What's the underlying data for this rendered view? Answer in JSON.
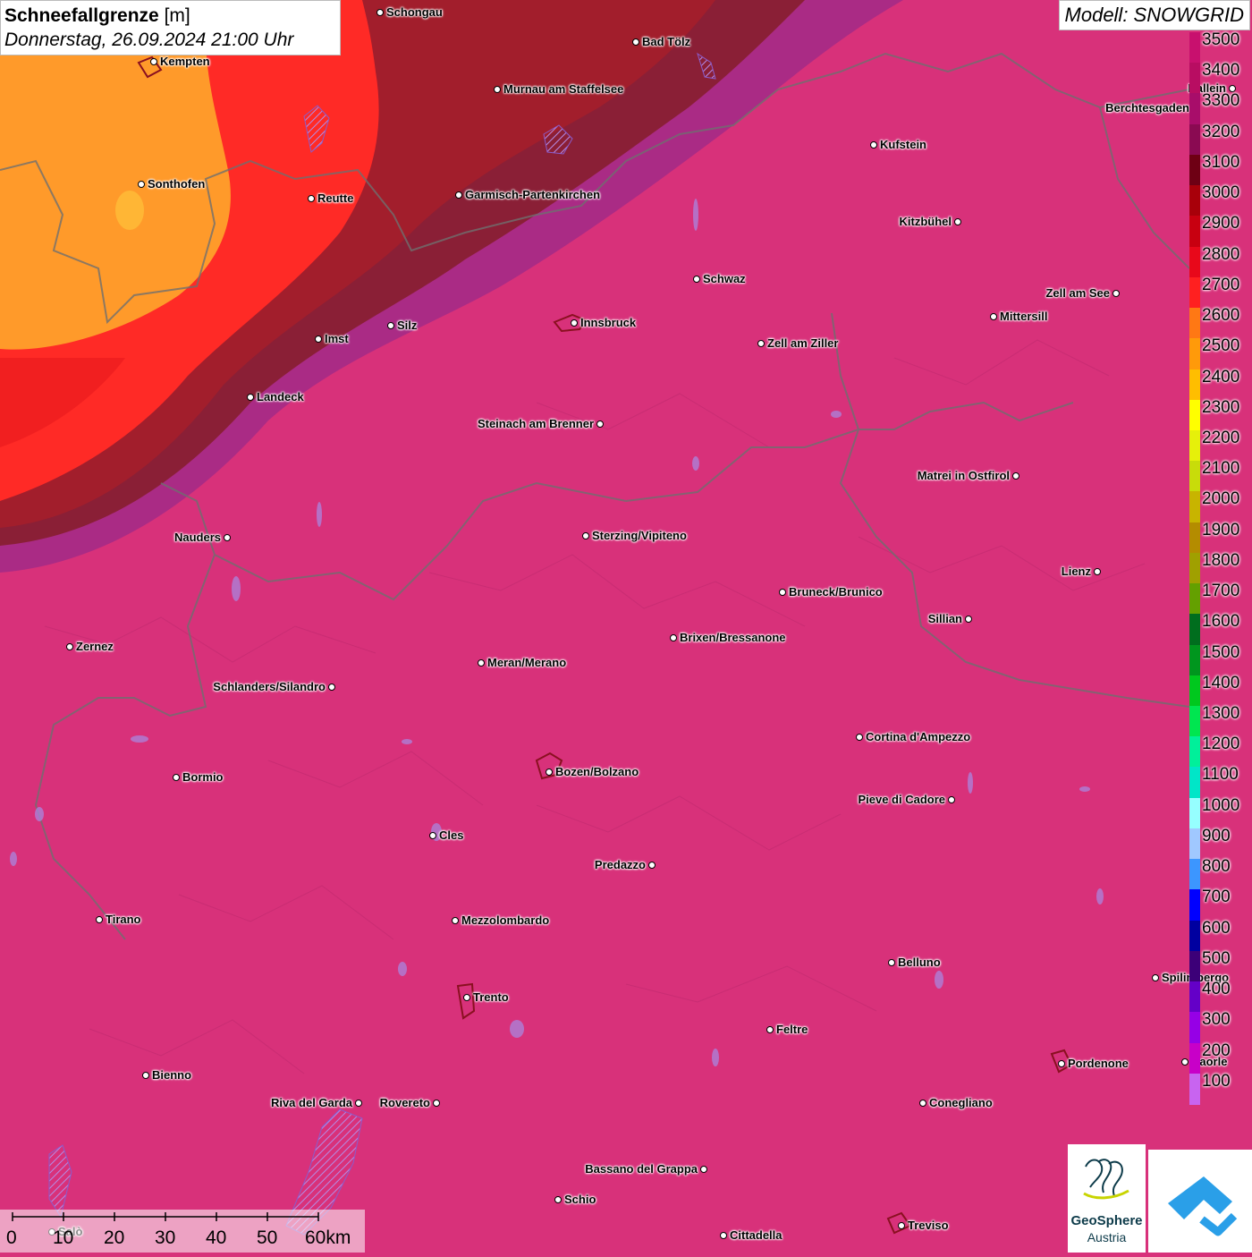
{
  "title": {
    "name": "Schneefallgrenze",
    "unit": "[m]",
    "datetime": "Donnerstag, 26.09.2024 21:00 Uhr"
  },
  "model": "Modell: SNOWGRID",
  "legend": [
    {
      "label": "3500",
      "color": "#c8106e"
    },
    {
      "label": "3400",
      "color": "#b80d62"
    },
    {
      "label": "3300",
      "color": "#a80d6a"
    },
    {
      "label": "3200",
      "color": "#8a0a52"
    },
    {
      "label": "3100",
      "color": "#6e0014"
    },
    {
      "label": "3000",
      "color": "#a8000a"
    },
    {
      "label": "2900",
      "color": "#c80010"
    },
    {
      "label": "2800",
      "color": "#e8081a"
    },
    {
      "label": "2700",
      "color": "#ff2020"
    },
    {
      "label": "2600",
      "color": "#ff7814"
    },
    {
      "label": "2500",
      "color": "#ff9a0a"
    },
    {
      "label": "2400",
      "color": "#ffbe00"
    },
    {
      "label": "2300",
      "color": "#ffff00"
    },
    {
      "label": "2200",
      "color": "#e6f00a"
    },
    {
      "label": "2100",
      "color": "#c8dc0a"
    },
    {
      "label": "2000",
      "color": "#c8b400"
    },
    {
      "label": "1900",
      "color": "#b48c00"
    },
    {
      "label": "1800",
      "color": "#a0a000"
    },
    {
      "label": "1700",
      "color": "#64a000"
    },
    {
      "label": "1600",
      "color": "#006e1e"
    },
    {
      "label": "1500",
      "color": "#00961e"
    },
    {
      "label": "1400",
      "color": "#00c81e"
    },
    {
      "label": "1300",
      "color": "#00e650"
    },
    {
      "label": "1200",
      "color": "#00f09a"
    },
    {
      "label": "1100",
      "color": "#00e6c8"
    },
    {
      "label": "1000",
      "color": "#96ffff"
    },
    {
      "label": "900",
      "color": "#a0c8ff"
    },
    {
      "label": "800",
      "color": "#3c96ff"
    },
    {
      "label": "700",
      "color": "#0000ff"
    },
    {
      "label": "600",
      "color": "#0000a0"
    },
    {
      "label": "500",
      "color": "#3c0078"
    },
    {
      "label": "400",
      "color": "#6400c8"
    },
    {
      "label": "300",
      "color": "#9600e6"
    },
    {
      "label": "200",
      "color": "#c800c8"
    },
    {
      "label": "100",
      "color": "#c864f0"
    }
  ],
  "cities": [
    {
      "name": "Schongau",
      "side": "r"
    },
    {
      "name": "Bad Tölz",
      "side": "r"
    },
    {
      "name": "Kempten",
      "side": "r"
    },
    {
      "name": "Murnau am Staffelsee",
      "side": "r"
    },
    {
      "name": "Berchtesgaden",
      "side": "l"
    },
    {
      "name": "Hallein",
      "side": "l"
    },
    {
      "name": "Kufstein",
      "side": "r"
    },
    {
      "name": "Sonthofen",
      "side": "r"
    },
    {
      "name": "Reutte",
      "side": "r"
    },
    {
      "name": "Garmisch-Partenkirchen",
      "side": "r"
    },
    {
      "name": "Kitzbühel",
      "side": "l"
    },
    {
      "name": "Schwaz",
      "side": "r"
    },
    {
      "name": "Zell am See",
      "side": "l"
    },
    {
      "name": "Mittersill",
      "side": "r"
    },
    {
      "name": "Innsbruck",
      "side": "r"
    },
    {
      "name": "Silz",
      "side": "r"
    },
    {
      "name": "Imst",
      "side": "r"
    },
    {
      "name": "Zell am Ziller",
      "side": "r"
    },
    {
      "name": "Landeck",
      "side": "r"
    },
    {
      "name": "Steinach am Brenner",
      "side": "l"
    },
    {
      "name": "Matrei in Ostfirol",
      "side": "l"
    },
    {
      "name": "Nauders",
      "side": "l"
    },
    {
      "name": "Sterzing/Vipiteno",
      "side": "r"
    },
    {
      "name": "Lienz",
      "side": "l"
    },
    {
      "name": "Bruneck/Brunico",
      "side": "r"
    },
    {
      "name": "Sillian",
      "side": "l"
    },
    {
      "name": "Brixen/Bressanone",
      "side": "r"
    },
    {
      "name": "Zernez",
      "side": "r"
    },
    {
      "name": "Meran/Merano",
      "side": "r"
    },
    {
      "name": "Schlanders/Silandro",
      "side": "l"
    },
    {
      "name": "Cortina d'Ampezzo",
      "side": "r"
    },
    {
      "name": "Bozen/Bolzano",
      "side": "r"
    },
    {
      "name": "Bormio",
      "side": "r"
    },
    {
      "name": "Pieve di Cadore",
      "side": "l"
    },
    {
      "name": "Cles",
      "side": "r"
    },
    {
      "name": "Predazzo",
      "side": "l"
    },
    {
      "name": "Tirano",
      "side": "r"
    },
    {
      "name": "Mezzolombardo",
      "side": "r"
    },
    {
      "name": "Belluno",
      "side": "r"
    },
    {
      "name": "Spilimbergo",
      "side": "r"
    },
    {
      "name": "Trento",
      "side": "r"
    },
    {
      "name": "Feltre",
      "side": "r"
    },
    {
      "name": "Pordenone",
      "side": "r"
    },
    {
      "name": "Bienno",
      "side": "r"
    },
    {
      "name": "Riva del Garda",
      "side": "l"
    },
    {
      "name": "Rovereto",
      "side": "l"
    },
    {
      "name": "Conegliano",
      "side": "r"
    },
    {
      "name": "Bassano del Grappa",
      "side": "l"
    },
    {
      "name": "Schio",
      "side": "r"
    },
    {
      "name": "Treviso",
      "side": "r"
    },
    {
      "name": "Cittadella",
      "side": "r"
    },
    {
      "name": "Caorle",
      "side": "r"
    },
    {
      "name": "Salò",
      "side": "r"
    }
  ],
  "scalebar": {
    "labels": [
      "0",
      "10",
      "20",
      "30",
      "40",
      "50",
      "60km"
    ]
  },
  "logos": {
    "geosphere_line1": "GeoSphere",
    "geosphere_line2": "Austria"
  }
}
